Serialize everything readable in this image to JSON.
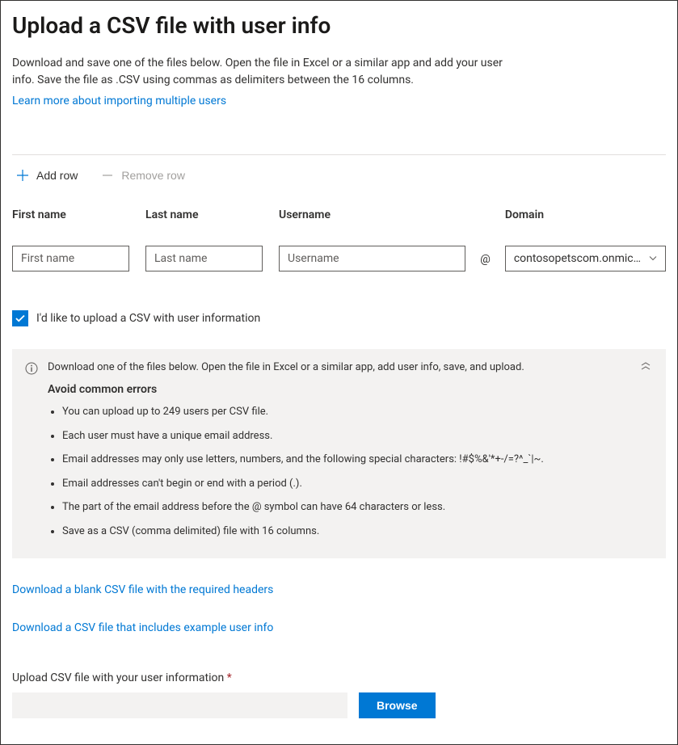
{
  "title": "Upload a CSV file with user info",
  "intro": "Download and save one of the files below. Open the file in Excel or a similar app and add your user info. Save the file as .CSV using commas as delimiters between the 16 columns.",
  "learn_more": "Learn more about importing multiple users",
  "actions": {
    "add_row": "Add row",
    "remove_row": "Remove row"
  },
  "fields": {
    "first_name": {
      "label": "First name",
      "placeholder": "First name",
      "value": ""
    },
    "last_name": {
      "label": "Last name",
      "placeholder": "Last name",
      "value": ""
    },
    "username": {
      "label": "Username",
      "placeholder": "Username",
      "value": ""
    },
    "domain": {
      "label": "Domain",
      "selected": "contosopetscom.onmic…"
    }
  },
  "at_symbol": "@",
  "checkbox": {
    "label": "I'd like to upload a CSV with user information",
    "checked": true
  },
  "info_panel": {
    "header": "Download one of the files below. Open the file in Excel or a similar app, add user info, save, and upload.",
    "subtitle": "Avoid common errors",
    "bullets": [
      "You can upload up to 249 users per CSV file.",
      "Each user must have a unique email address.",
      "Email addresses may only use letters, numbers, and the following special characters: !#$%&'*+-/=?^_`|~.",
      "Email addresses can't begin or end with a period (.).",
      "The part of the email address before the @ symbol can have 64 characters or less.",
      "Save as a CSV (comma delimited) file with 16 columns."
    ]
  },
  "downloads": {
    "blank": "Download a blank CSV file with the required headers",
    "example": "Download a CSV file that includes example user info"
  },
  "upload": {
    "label": "Upload CSV file with your user information",
    "required_mark": "*",
    "browse": "Browse"
  }
}
